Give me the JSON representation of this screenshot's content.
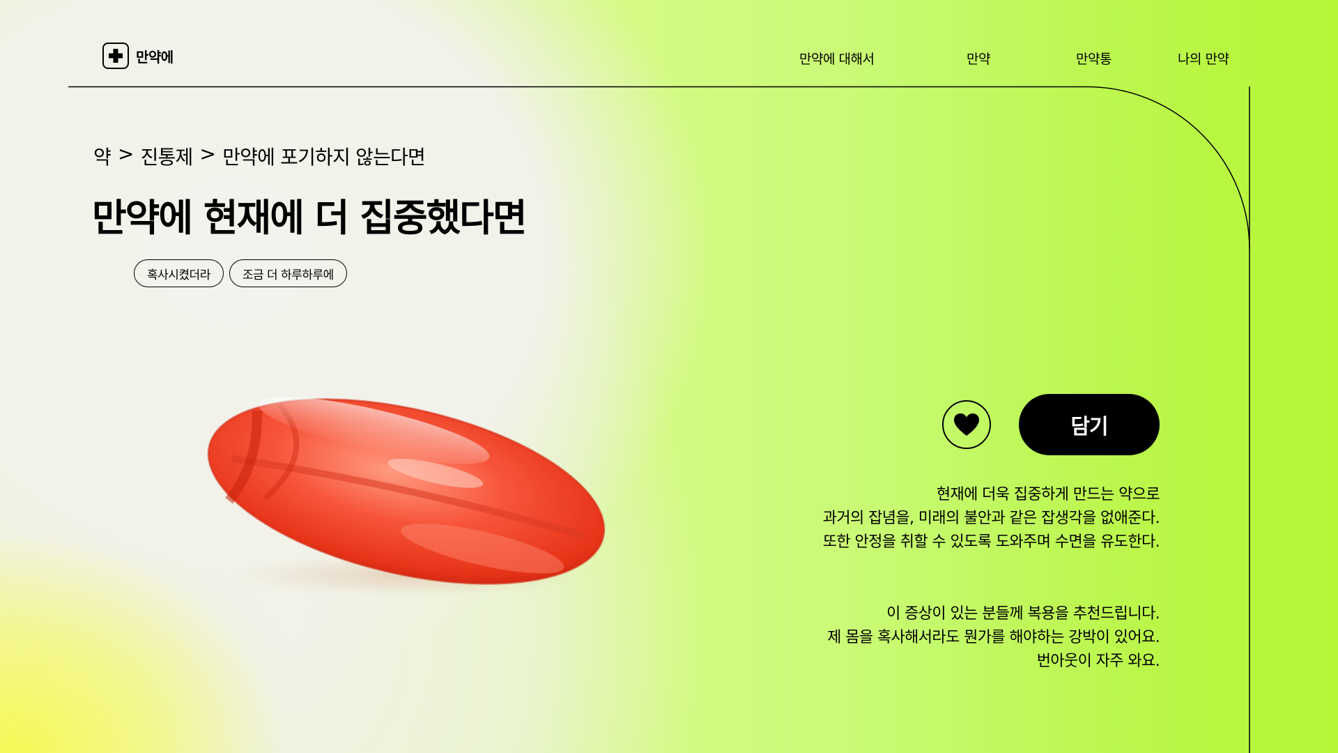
{
  "header": {
    "logo_text": "만약에",
    "nav": [
      {
        "label": "만약에 대해서"
      },
      {
        "label": "만약"
      },
      {
        "label": "만약통"
      },
      {
        "label": "나의 만약"
      }
    ]
  },
  "product": {
    "breadcrumb": [
      "약",
      ">",
      "진통제",
      ">",
      "만약에 포기하지 않는다면"
    ],
    "title": "만약에 현재에 더 집중했다면",
    "tags": [
      "혹사시켰더라",
      "조금 더 하루하루에"
    ]
  },
  "actions": {
    "like_icon": "heart-icon",
    "cart_label": "담기"
  },
  "description": {
    "paragraph1": [
      "현재에 더욱 집중하게 만드는 약으로",
      "과거의 잡념을, 미래의 불안과 같은 잡생각을 없애준다.",
      "또한 안정을 취할 수 있도록 도와주며 수면을 유도한다."
    ],
    "paragraph2": [
      "이 증상이 있는 분들께 복용을 추천드립니다.",
      "제 몸을 혹사해서라도 뭔가를 해야하는 강박이 있어요.",
      "번아웃이 자주 와요."
    ]
  },
  "colors": {
    "accent_green": "#c6fa70",
    "capsule_red": "#f0452e",
    "button_black": "#000000"
  }
}
